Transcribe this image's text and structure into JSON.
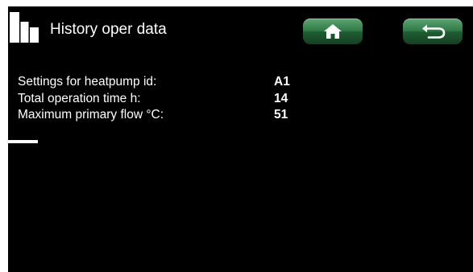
{
  "header": {
    "title": "History oper data",
    "app_icon": "bar-chart-icon",
    "home_icon": "home-icon",
    "back_icon": "back-arrow-icon"
  },
  "colors": {
    "background": "#000000",
    "text": "#ffffff",
    "button_green": "#2f7a47"
  },
  "rows": [
    {
      "label": "Settings for heatpump id:",
      "value": "A1"
    },
    {
      "label": "Total operation time h:",
      "value": "14"
    },
    {
      "label": "Maximum primary flow °C:",
      "value": "51"
    }
  ]
}
